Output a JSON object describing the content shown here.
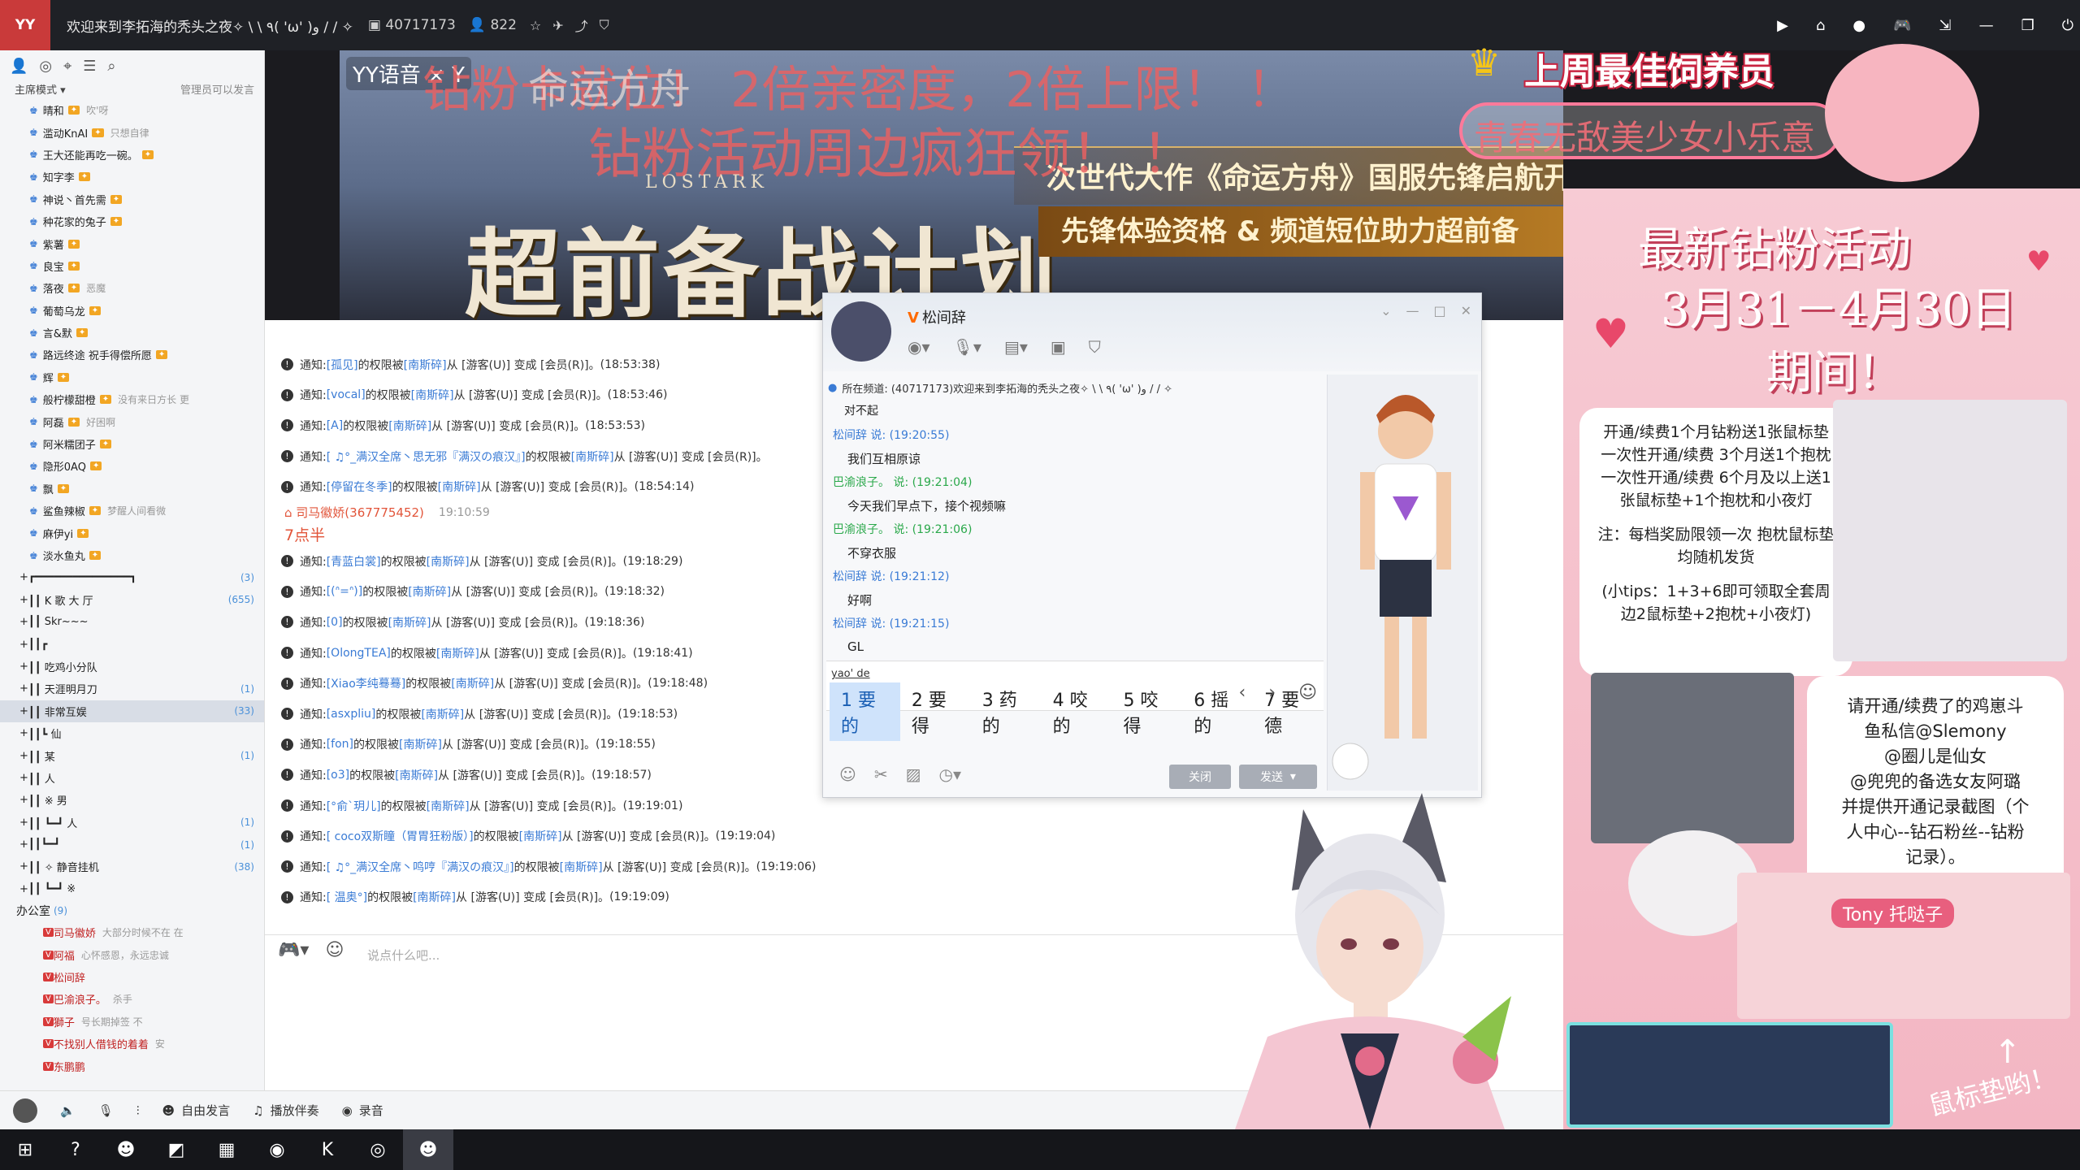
{
  "titlebar": {
    "channel_title": "欢迎来到李拓海的秃头之夜✧ \\ \\ ٩( 'ω' )و / / ✧",
    "channel_id": "40717173",
    "online_count": "822"
  },
  "left_panel": {
    "mode": "主席模式",
    "admin_speak": "管理员可以发言",
    "members": [
      {
        "name": "晴和",
        "sig": "吹'呀"
      },
      {
        "name": "滥动KnAI",
        "sig": "只想自律"
      },
      {
        "name": "王大还能再吃一碗。",
        "sig": ""
      },
      {
        "name": "知字李",
        "sig": ""
      },
      {
        "name": "神说丶首先需",
        "sig": ""
      },
      {
        "name": "种花家的兔子",
        "sig": ""
      },
      {
        "name": "紫薯",
        "sig": ""
      },
      {
        "name": "良宝",
        "sig": ""
      },
      {
        "name": "落夜",
        "sig": "恶魔"
      },
      {
        "name": "葡萄乌龙",
        "sig": ""
      },
      {
        "name": "言&默",
        "sig": ""
      },
      {
        "name": "路远终途 祝手得偿所愿",
        "sig": ""
      },
      {
        "name": "辉",
        "sig": ""
      },
      {
        "name": "般柠檬甜橙",
        "sig": "没有来日方长 更"
      },
      {
        "name": "阿磊",
        "sig": "好困啊"
      },
      {
        "name": "阿米糯团子",
        "sig": ""
      },
      {
        "name": "隐形0AQ",
        "sig": ""
      },
      {
        "name": "飘",
        "sig": ""
      },
      {
        "name": "鲨鱼辣椒",
        "sig": "梦醒人间看微"
      },
      {
        "name": "麻伊yi",
        "sig": ""
      },
      {
        "name": "淡水鱼丸",
        "sig": ""
      }
    ],
    "channels": [
      {
        "name": "┏━━━━━━━━━━━━━━━┓",
        "count": "(3)"
      },
      {
        "name": "┃┃    K 歌 大 厅",
        "count": "(655)"
      },
      {
        "name": "┃┃    Skr~~~",
        "count": ""
      },
      {
        "name": "┃┃┏",
        "count": ""
      },
      {
        "name": "┃┃ 吃鸡小分队",
        "count": ""
      },
      {
        "name": "┃┃ 天涯明月刀",
        "count": "(1)"
      },
      {
        "name": "┃┃ 非常互娱",
        "count": "(33)"
      },
      {
        "name": "┃┃┗          仙",
        "count": ""
      },
      {
        "name": "┃┃             某",
        "count": "(1)"
      },
      {
        "name": "┃┃             人",
        "count": ""
      },
      {
        "name": "┃┃       ※     男",
        "count": ""
      },
      {
        "name": "┃┃   ┗━┛       人",
        "count": "(1)"
      },
      {
        "name": "┃┃┗━┛",
        "count": "(1)"
      },
      {
        "name": "┃┃ ✧   静音挂机",
        "count": "(38)"
      },
      {
        "name": "┃┃ ┗━┛    ※",
        "count": ""
      }
    ],
    "office": {
      "name": "办公室",
      "count": "(9)"
    },
    "office_members": [
      {
        "name": "司马徽娇",
        "sig": "大部分时候不在 在"
      },
      {
        "name": "阿福",
        "sig": "心怀感恩，永远忠诚"
      },
      {
        "name": "松间辞",
        "sig": ""
      },
      {
        "name": "巴渝浪子。",
        "sig": "杀手"
      },
      {
        "name": "獅子",
        "sig": "号长期掉签 不"
      },
      {
        "name": "不找别人借钱的着着",
        "sig": "安"
      },
      {
        "name": "东鹏鹏",
        "sig": ""
      }
    ]
  },
  "banner": {
    "yy_label": "YY语音 × Y",
    "overlay_line1": "钻粉卡就位！ 2倍亲密度，2倍上限！ ！",
    "overlay_line2": "钻粉活动周边疯狂领！ ！",
    "game_logo": "命运方舟",
    "game_en": "LOSTARK",
    "main_title": "超前备战计划",
    "sub1": "次世代大作《命运方舟》国服先锋启航开启",
    "sub2": "先锋体验资格 & 频道短位助力超前备"
  },
  "chat": {
    "notifications": [
      {
        "name": "[孤见]",
        "admin": "[南斯碎]",
        "time": "(18:53:38)"
      },
      {
        "name": "[vocal]",
        "admin": "[南斯碎]",
        "time": "(18:53:46)"
      },
      {
        "name": "[A]",
        "admin": "[南斯碎]",
        "time": "(18:53:53)"
      },
      {
        "name": "[   ♫°_满汉全席丶思无邪『满汉の痕汉』]",
        "admin": "[南斯碎]",
        "time": ""
      },
      {
        "name": "[停留在冬季]",
        "admin": "[南斯碎]",
        "time": "(18:54:14)"
      }
    ],
    "message": {
      "name": "司马徽娇(367775452)",
      "time": "19:10:59",
      "text": "7点半"
    },
    "notifications2": [
      {
        "name": "[青蓝白裳]",
        "admin": "[南斯碎]",
        "time": "(19:18:29)"
      },
      {
        "name": "[(ᐢ=ᐢ)]",
        "admin": "[南斯碎]",
        "time": "(19:18:32)"
      },
      {
        "name": "[0]",
        "admin": "[南斯碎]",
        "time": "(19:18:36)"
      },
      {
        "name": "[OlongTEA]",
        "admin": "[南斯碎]",
        "time": "(19:18:41)"
      },
      {
        "name": "[Xiao李纯蓦蓦]",
        "admin": "[南斯碎]",
        "time": "(19:18:48)"
      },
      {
        "name": "[asxpliu]",
        "admin": "[南斯碎]",
        "time": "(19:18:53)"
      },
      {
        "name": "[fon]",
        "admin": "[南斯碎]",
        "time": "(19:18:55)"
      },
      {
        "name": "[o3]",
        "admin": "[南斯碎]",
        "time": "(19:18:57)"
      },
      {
        "name": "[°俞`玥儿]",
        "admin": "[南斯碎]",
        "time": "(19:19:01)"
      },
      {
        "name": "[   coco双斯瞳（胃胃狂粉版）]",
        "admin": "[南斯碎]",
        "time": "(19:19:04)"
      },
      {
        "name": "[   ♫°_满汉全席丶鸣哼『满汉の痕汉』]",
        "admin": "[南斯碎]",
        "time": "(19:19:06)"
      },
      {
        "name": "[   温奥°]",
        "admin": "[南斯碎]",
        "time": "(19:19:09)"
      }
    ],
    "notice_label": "通知:",
    "perm_text": "的权限被",
    "change_text": "从 [游客(U)] 变成 [会员(R)]。",
    "input_placeholder": "说点什么吧..."
  },
  "bottombar": {
    "free_speak": "自由发言",
    "music": "播放伴奏",
    "record": "录音"
  },
  "pm_window": {
    "username": "松间辞",
    "channel_notice": "所在频道: (40717173)欢迎来到李拓海的秃头之夜✧ \\ \\ ٩( 'ω' )و / / ✧",
    "first_msg": "对不起",
    "messages": [
      {
        "name": "松间辞 说: (19:20:55)",
        "text": "我们互相原谅",
        "green": false
      },
      {
        "name": "巴渝浪子。 说: (19:21:04)",
        "text": "今天我们早点下，接个视频嘛",
        "green": true
      },
      {
        "name": "巴渝浪子。 说: (19:21:06)",
        "text": "不穿衣服",
        "green": true
      },
      {
        "name": "松间辞 说: (19:21:12)",
        "text": "好啊",
        "green": false
      },
      {
        "name": "松间辞 说: (19:21:15)",
        "text": "GL",
        "green": false
      }
    ],
    "ime_input": "yao' de",
    "candidates": [
      "1 要的",
      "2 要得",
      "3 药的",
      "4 咬的",
      "5 咬得",
      "6 摇的",
      "7 要德"
    ],
    "close_label": "关闭",
    "send_label": "发送"
  },
  "best_donor": {
    "title": "上周最佳饲养员",
    "name": "青春无敌美少女小乐意"
  },
  "right_panel": {
    "title1": "最新钻粉活动",
    "title2": "3月31－4月30日",
    "title3": "期间！",
    "card1": [
      "开通/续费1个月钻粉送1张鼠标垫",
      "一次性开通/续费 3个月送1个抱枕",
      "一次性开通/续费 6个月及以上送1",
      "张鼠标垫+1个抱枕和小夜灯",
      "注：每档奖励限领一次 抱枕鼠标垫",
      "均随机发货",
      "(小tips：1+3+6即可领取全套周",
      "边2鼠标垫+2抱枕+小夜灯)"
    ],
    "card2": [
      "请开通/续费了的鸡崽斗",
      "鱼私信@Slemony",
      "@圈儿是仙女",
      "@兜兜的备选女友阿璐",
      "并提供开通记录截图（个",
      "人中心--钻石粉丝--钻粉",
      "记录）。"
    ],
    "mousepad_label": "鼠标垫哟！",
    "tony_label": "Tony 托哒子"
  }
}
